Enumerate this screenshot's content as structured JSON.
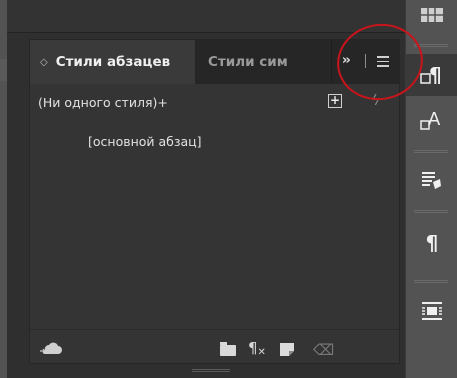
{
  "panel": {
    "tab_active": "Стили абзацев",
    "tab_inactive": "Стили сим",
    "more_label": "››",
    "rows": {
      "none_style": "(Ни одного стиля)+",
      "basic_paragraph": "[основной абзац]"
    },
    "icons": {
      "plus": "+",
      "bolt": "ϟ",
      "pilcrow": "¶",
      "trash": "🗑"
    }
  },
  "dock": {
    "items": [
      {
        "icon": "pages-grid-icon"
      },
      {
        "icon": "paragraph-styles-icon",
        "glyph": "¶",
        "active": true
      },
      {
        "icon": "character-styles-icon",
        "glyph": "A"
      },
      {
        "icon": "object-styles-icon"
      },
      {
        "icon": "paragraph-icon",
        "glyph": "¶"
      },
      {
        "icon": "text-wrap-icon"
      }
    ]
  },
  "colors": {
    "panel_bg": "#343434",
    "dock_bg": "#535353",
    "annotation": "#c8151b"
  }
}
